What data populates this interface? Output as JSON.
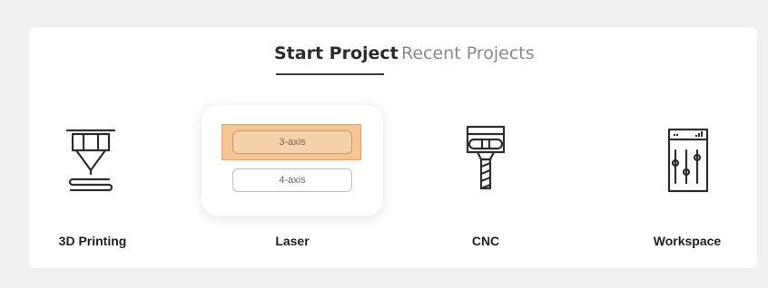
{
  "tabs": [
    {
      "label": "Start Project",
      "active": true
    },
    {
      "label": "Recent Projects",
      "active": false
    }
  ],
  "tiles": [
    {
      "label": "3D Printing",
      "icon": "3d-printer-nozzle-icon"
    },
    {
      "label": "Laser",
      "icon": "laser-icon",
      "options": [
        "3-axis",
        "4-axis"
      ],
      "highlighted_option": "3-axis"
    },
    {
      "label": "CNC",
      "icon": "cnc-spindle-icon"
    },
    {
      "label": "Workspace",
      "icon": "workspace-sliders-icon"
    }
  ],
  "colors": {
    "background": "#f1f1f3",
    "card": "#ffffff",
    "highlight": "#f8c493",
    "highlight_border": "#f0a15a"
  }
}
